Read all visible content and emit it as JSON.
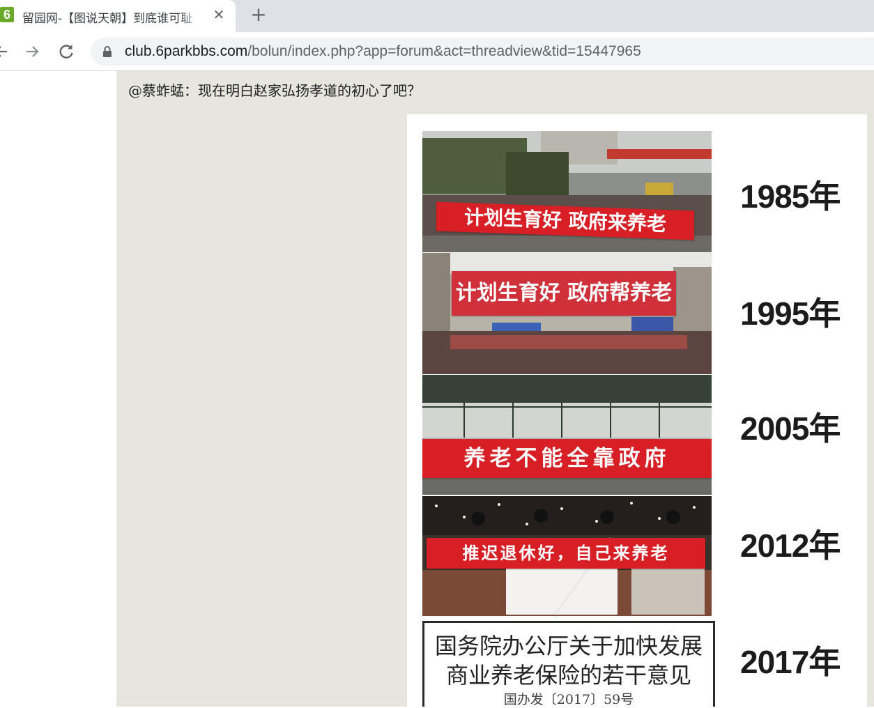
{
  "browser": {
    "tab": {
      "favicon_text": "6",
      "title": "留园网-【图说天朝】到底谁可耻",
      "close_glyph": "✕"
    },
    "new_tab_glyph": "+",
    "address": {
      "host": "club.6parkbbs.com",
      "path": "/bolun/index.php?app=forum&act=threadview&tid=15447965"
    }
  },
  "post": {
    "text": "@蔡蚱蜢：现在明白赵家弘扬孝道的初心了吧？"
  },
  "image": {
    "panels": [
      {
        "year": "1985年",
        "banner": "计划生育好 政府来养老"
      },
      {
        "year": "1995年",
        "banner": "计划生育好 政府帮养老"
      },
      {
        "year": "2005年",
        "banner": "养老不能全靠政府"
      },
      {
        "year": "2012年",
        "banner": "推迟退休好，自己来养老"
      },
      {
        "year": "2017年"
      }
    ],
    "document": {
      "title_line1": "国务院办公厅关于加快发展",
      "title_line2": "商业养老保险的若干意见",
      "doc_number": "国办发〔2017〕59号"
    }
  },
  "colors": {
    "banner_red": "#d81f26",
    "post_background": "#e6e6df",
    "favicon_green": "#6aa82a"
  }
}
